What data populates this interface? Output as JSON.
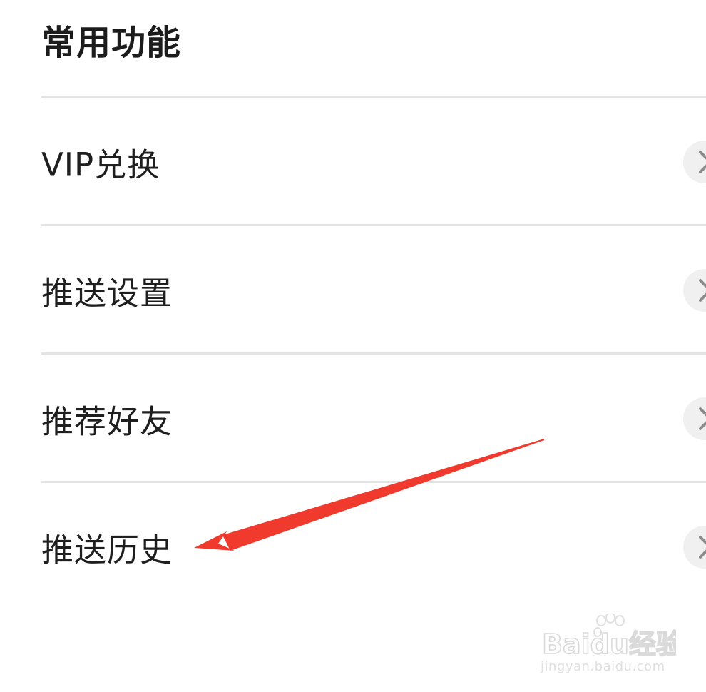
{
  "section": {
    "title": "常用功能"
  },
  "menu": {
    "items": [
      {
        "label": "VIP兑换",
        "icon": "chevron-right-icon"
      },
      {
        "label": "推送设置",
        "icon": "chevron-right-icon"
      },
      {
        "label": "推荐好友",
        "icon": "chevron-right-icon"
      },
      {
        "label": "推送历史",
        "icon": "chevron-right-icon"
      }
    ]
  },
  "annotation": {
    "type": "arrow",
    "color": "#f03a2e",
    "points_to": "推送历史"
  },
  "watermark": {
    "brand": "Baidu经验",
    "url": "jingyan.baidu.com"
  },
  "colors": {
    "divider": "#e3e3e3",
    "text": "#1f1f1f",
    "chevron_bg": "#f0f0f0",
    "chevron_stroke": "#8c8c8c"
  }
}
